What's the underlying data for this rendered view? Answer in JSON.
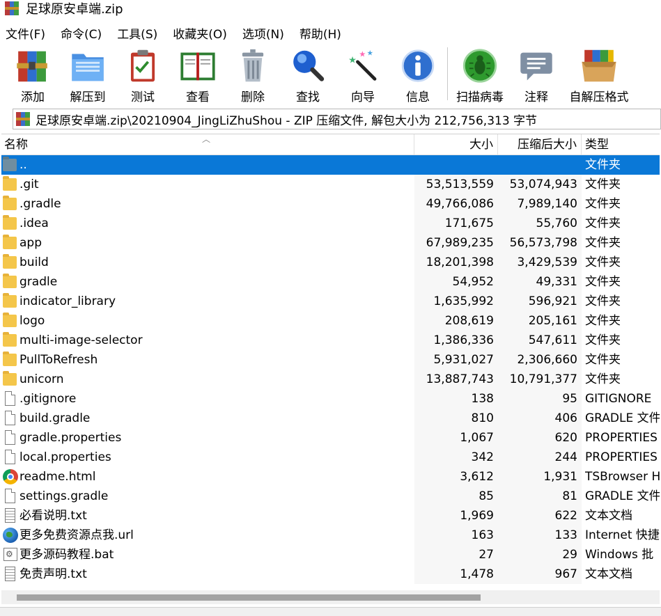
{
  "window": {
    "title": "足球原安卓端.zip"
  },
  "menu": [
    {
      "label": "文件(F)"
    },
    {
      "label": "命令(C)"
    },
    {
      "label": "工具(S)"
    },
    {
      "label": "收藏夹(O)"
    },
    {
      "label": "选项(N)"
    },
    {
      "label": "帮助(H)"
    }
  ],
  "toolbar": {
    "add": "添加",
    "extract": "解压到",
    "test": "测试",
    "view": "查看",
    "delete": "删除",
    "find": "查找",
    "wizard": "向导",
    "info": "信息",
    "scan": "扫描病毒",
    "comment": "注释",
    "sfx": "自解压格式"
  },
  "address": {
    "path": "足球原安卓端.zip\\20210904_JingLiZhuShou - ZIP 压缩文件, 解包大小为 212,756,313 字节"
  },
  "columns": {
    "name": "名称",
    "size": "大小",
    "packed": "压缩后大小",
    "type": "类型"
  },
  "files": [
    {
      "name": "..",
      "size": "",
      "packed": "",
      "type": "文件夹",
      "icon": "folder-up-icon"
    },
    {
      "name": ".git",
      "size": "53,513,559",
      "packed": "53,074,943",
      "type": "文件夹",
      "icon": "folder-icon"
    },
    {
      "name": ".gradle",
      "size": "49,766,086",
      "packed": "7,989,140",
      "type": "文件夹",
      "icon": "folder-icon"
    },
    {
      "name": ".idea",
      "size": "171,675",
      "packed": "55,760",
      "type": "文件夹",
      "icon": "folder-icon"
    },
    {
      "name": "app",
      "size": "67,989,235",
      "packed": "56,573,798",
      "type": "文件夹",
      "icon": "folder-icon"
    },
    {
      "name": "build",
      "size": "18,201,398",
      "packed": "3,429,539",
      "type": "文件夹",
      "icon": "folder-icon"
    },
    {
      "name": "gradle",
      "size": "54,952",
      "packed": "49,331",
      "type": "文件夹",
      "icon": "folder-icon"
    },
    {
      "name": "indicator_library",
      "size": "1,635,992",
      "packed": "596,921",
      "type": "文件夹",
      "icon": "folder-icon"
    },
    {
      "name": "logo",
      "size": "208,619",
      "packed": "205,161",
      "type": "文件夹",
      "icon": "folder-icon"
    },
    {
      "name": "multi-image-selector",
      "size": "1,386,336",
      "packed": "547,611",
      "type": "文件夹",
      "icon": "folder-icon"
    },
    {
      "name": "PullToRefresh",
      "size": "5,931,027",
      "packed": "2,306,660",
      "type": "文件夹",
      "icon": "folder-icon"
    },
    {
      "name": "unicorn",
      "size": "13,887,743",
      "packed": "10,791,377",
      "type": "文件夹",
      "icon": "folder-icon"
    },
    {
      "name": ".gitignore",
      "size": "138",
      "packed": "95",
      "type": "GITIGNORE",
      "icon": "file-icon"
    },
    {
      "name": "build.gradle",
      "size": "810",
      "packed": "406",
      "type": "GRADLE 文件",
      "icon": "file-icon"
    },
    {
      "name": "gradle.properties",
      "size": "1,067",
      "packed": "620",
      "type": "PROPERTIES",
      "icon": "file-icon"
    },
    {
      "name": "local.properties",
      "size": "342",
      "packed": "244",
      "type": "PROPERTIES",
      "icon": "file-icon"
    },
    {
      "name": "readme.html",
      "size": "3,612",
      "packed": "1,931",
      "type": "TSBrowser H",
      "icon": "chrome-icon"
    },
    {
      "name": "settings.gradle",
      "size": "85",
      "packed": "81",
      "type": "GRADLE 文件",
      "icon": "file-icon"
    },
    {
      "name": "必看说明.txt",
      "size": "1,969",
      "packed": "622",
      "type": "文本文档",
      "icon": "text-file-icon"
    },
    {
      "name": "更多免费资源点我.url",
      "size": "163",
      "packed": "133",
      "type": "Internet 快捷",
      "icon": "globe-icon"
    },
    {
      "name": "更多源码教程.bat",
      "size": "27",
      "packed": "29",
      "type": "Windows 批",
      "icon": "batch-file-icon"
    },
    {
      "name": "免责声明.txt",
      "size": "1,478",
      "packed": "967",
      "type": "文本文档",
      "icon": "text-file-icon"
    }
  ],
  "colors": {
    "selection": "#0a78d7",
    "folder": "#f4c64a"
  }
}
